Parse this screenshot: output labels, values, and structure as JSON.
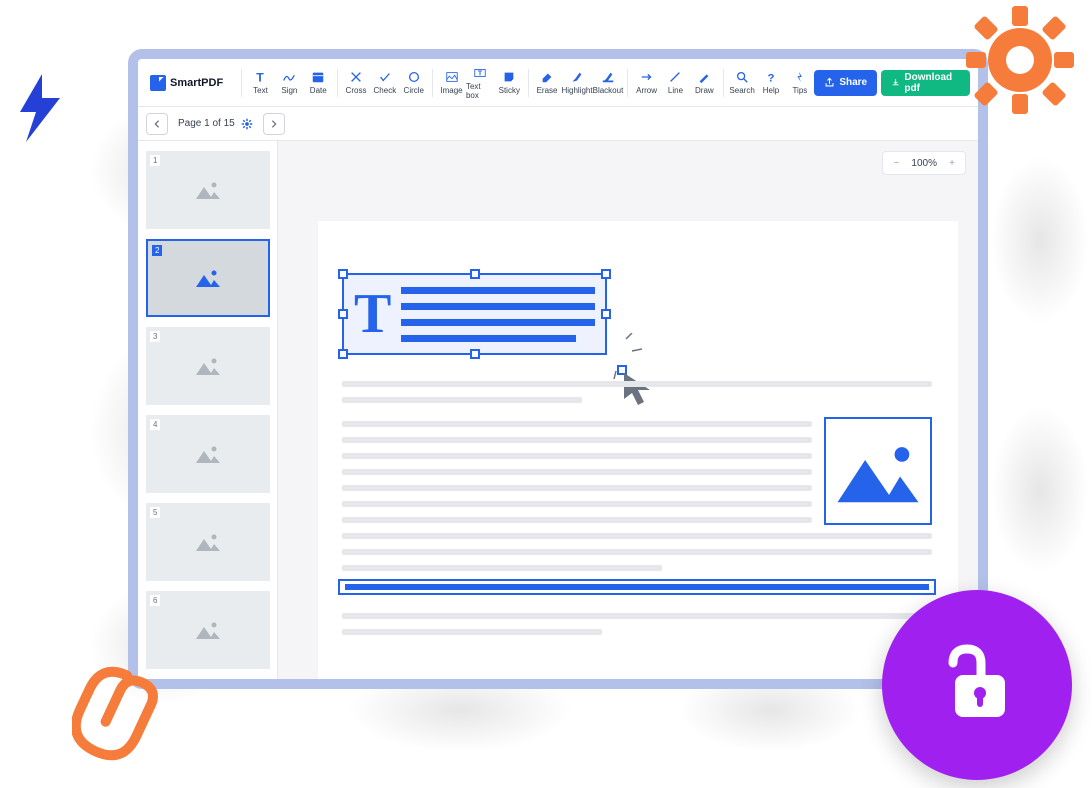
{
  "brand": {
    "name": "SmartPDF"
  },
  "toolbar": {
    "tools": [
      {
        "id": "text",
        "label": "Text"
      },
      {
        "id": "sign",
        "label": "Sign"
      },
      {
        "id": "date",
        "label": "Date"
      },
      {
        "id": "cross",
        "label": "Cross"
      },
      {
        "id": "check",
        "label": "Check"
      },
      {
        "id": "circle",
        "label": "Circle"
      },
      {
        "id": "image",
        "label": "Image"
      },
      {
        "id": "textbox",
        "label": "Text box"
      },
      {
        "id": "sticky",
        "label": "Sticky"
      },
      {
        "id": "erase",
        "label": "Erase"
      },
      {
        "id": "highlight",
        "label": "Highlight"
      },
      {
        "id": "blackout",
        "label": "Blackout"
      },
      {
        "id": "arrow",
        "label": "Arrow"
      },
      {
        "id": "line",
        "label": "Line"
      },
      {
        "id": "draw",
        "label": "Draw"
      }
    ],
    "utilities": [
      {
        "id": "search",
        "label": "Search"
      },
      {
        "id": "help",
        "label": "Help"
      },
      {
        "id": "tips",
        "label": "Tips"
      }
    ],
    "share": "Share",
    "download": "Download pdf"
  },
  "page_indicator": {
    "text": "Page 1 of 15"
  },
  "zoom": {
    "level": "100%"
  },
  "thumbnails": [
    {
      "page": 1,
      "active": false
    },
    {
      "page": 2,
      "active": true
    },
    {
      "page": 3,
      "active": false
    },
    {
      "page": 4,
      "active": false
    },
    {
      "page": 5,
      "active": false
    },
    {
      "page": 6,
      "active": false
    }
  ],
  "selection": {
    "glyph": "T"
  }
}
